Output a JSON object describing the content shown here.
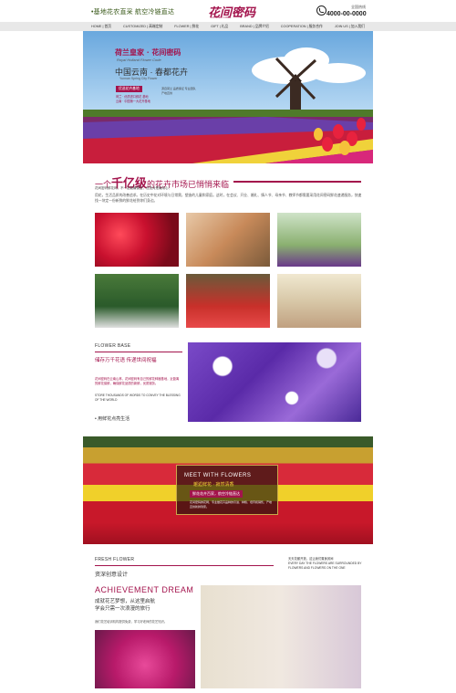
{
  "header": {
    "slogan": "•基地花农直采  航空冷链直达",
    "logo": "花间密码",
    "logo_sub": "FLOWER CODE",
    "phone_label": "全国热线",
    "phone": "4000-00-0000"
  },
  "nav": {
    "items": [
      "HOME | 首页",
      "CUSTOMIZED | 高端定制",
      "FLOWER | 鲜花",
      "GIFT | 礼品",
      "BRAND | 品牌介绍",
      "COOPERATION | 服务合作",
      "JOIN US | 加入我们"
    ]
  },
  "hero": {
    "title": "荷兰皇家 · 花间密码",
    "title_en": "Royal Holland Flower Code",
    "title2": "中国云南 · 春都花卉",
    "title2_en": "Yunnan Spring City Flower",
    "badge": "优选花卉基地",
    "note": "荷兰 · 优质进口鲜花 基地\n云南 · 中国第一大花卉基地",
    "note2": "源自荷兰 品质保证 专业团队 产地直供"
  },
  "intro": {
    "title_prefix": "一个",
    "title_big": "千亿级",
    "title_suffix": "的花卉市场已悄悄来临",
    "sub": "花间密码鲜花网，不一定能最便宜，但绝对是最用心！",
    "body": "用花，生活品质的改善追求。在历史中花对环境与日常需，塑造的儿童和家庭。这时，在会议、开业、婚礼、情人节、母亲节、教师节都需要采用花间密码鲜花速递服务，快速找一块定一份新鲜的鲜花给到你们身边。"
  },
  "base": {
    "title": "FLOWER BASE",
    "sub": "储存万千花语 传递世间祝福",
    "body": "花间密码在云南山林，花间密码有自己的鲜花种植基地，近距离的鲜花保鲜，确保鲜花品质的新鲜，优质服务。",
    "en": "STORE THOUSANDS OF WORDS TO CONVEY THE BLESSING OF THE WORLD",
    "foot": "• 用鲜花点亮生活"
  },
  "meet": {
    "title": "MEET WITH FLOWERS",
    "sub": "邂逅鲜花 · 寂然清香",
    "badge": "鲜花花卉百家，航空冷链直达",
    "body": "花间密码鲜花网，专业做花卉品种的引进、种植、培育和销售，产地直供新鲜到家。"
  },
  "fresh": {
    "title": "FRESH FLOWER",
    "sub": "资深创意设计",
    "side": "天天花都开放，这让我们置身其间\nEVERY DAY THE FLOWERS ARE SURROUNDED BY FLOWERS AND FLOWERS ON THE ONE",
    "ach": "ACHIEVEMENT DREAM",
    "ach_cn": "成就花艺梦想，从这里启航\n学会只需一次浪漫的旅行",
    "ach_body": "我们花艺培训机构提供免费，学习好老师的花艺知识。"
  },
  "colors": {
    "accent": "#a3134c",
    "nav_bg": "#e8e8e8"
  }
}
